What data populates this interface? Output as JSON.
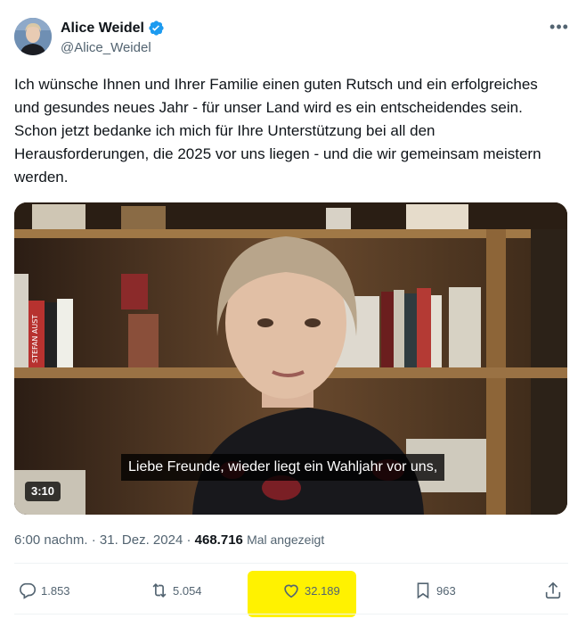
{
  "author": {
    "display_name": "Alice Weidel",
    "handle": "@Alice_Weidel",
    "verified": true,
    "avatar_icon": "avatar-photo"
  },
  "tweet": {
    "text": "Ich wünsche Ihnen und Ihrer Familie einen guten Rutsch und ein erfolgreiches und gesundes neues Jahr - für unser Land wird es ein entscheidendes sein. Schon jetzt bedanke ich mich für Ihre Unterstützung bei all den Herausforderungen, die 2025 vor uns liegen - und die wir gemeinsam meistern werden."
  },
  "media": {
    "subtitle": "Liebe Freunde, wieder liegt ein Wahljahr vor uns,",
    "duration": "3:10",
    "book_spine_text": "STEFAN AUST"
  },
  "meta": {
    "time": "6:00 nachm.",
    "separator": "·",
    "date": "31. Dez. 2024",
    "views": "468.716",
    "views_label": "Mal angezeigt"
  },
  "actions": {
    "replies": "1.853",
    "reposts": "5.054",
    "likes": "32.189",
    "bookmarks": "963"
  },
  "colors": {
    "verified_blue": "#1d9bf0",
    "secondary_text": "#536471",
    "highlight": "#fff200"
  }
}
